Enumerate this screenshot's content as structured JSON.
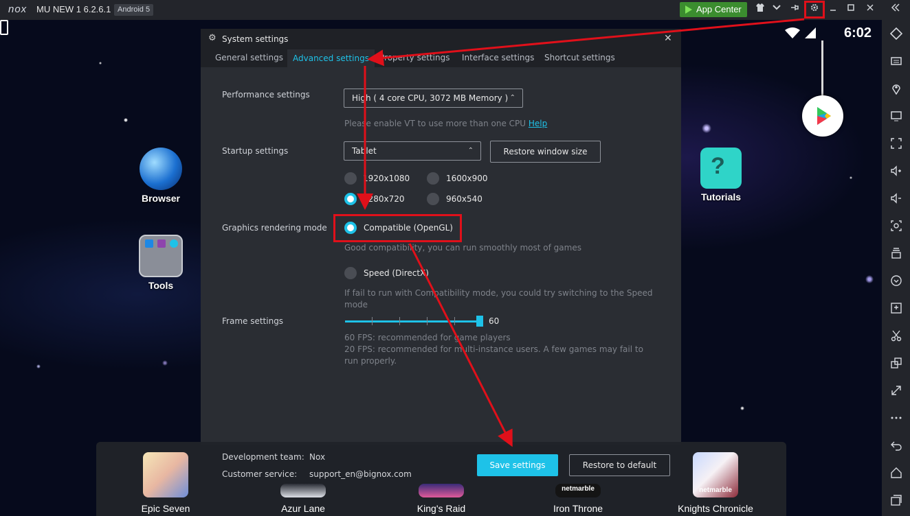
{
  "titlebar": {
    "logo": "nox",
    "title": "MU NEW 1 6.2.6.1",
    "android_badge": "Android 5",
    "app_center_label": "App Center"
  },
  "screen": {
    "time": "6:02",
    "apps": [
      {
        "label": "Browser"
      },
      {
        "label": "Tools"
      },
      {
        "label": "Tutorials"
      }
    ]
  },
  "dialog": {
    "title": "System settings",
    "tabs": [
      "General settings",
      "Advanced settings",
      "Property settings",
      "Interface settings",
      "Shortcut settings"
    ],
    "performance": {
      "label": "Performance settings",
      "value": "High ( 4 core CPU, 3072 MB Memory )",
      "hint": "Please enable VT to use more than one CPU",
      "hint_link": "Help"
    },
    "startup": {
      "label": "Startup settings",
      "value": "Tablet",
      "restore_button": "Restore window size",
      "resolutions": [
        "1920x1080",
        "1600x900",
        "1280x720",
        "960x540"
      ],
      "selected": "1280x720"
    },
    "graphics": {
      "label": "Graphics rendering mode",
      "compatible": "Compatible (OpenGL)",
      "compatible_hint": "Good compatibility, you can run smoothly most of games",
      "speed": "Speed (DirectX)",
      "speed_hint": "If fail to run with Compatibility mode, you could try switching to the Speed mode"
    },
    "frame": {
      "label": "Frame settings",
      "value": "60",
      "hint_1": "60 FPS: recommended for game players",
      "hint_2": "20 FPS: recommended for multi-instance users. A few games may fail to run properly."
    }
  },
  "footer": {
    "dev_team_key": "Development team:",
    "dev_team_value": "Nox",
    "customer_service_key": "Customer service:",
    "customer_service_value": "support_en@bignox.com",
    "save_button": "Save settings",
    "restore_default_button": "Restore to default",
    "games": [
      {
        "label": "Epic Seven"
      },
      {
        "label": "Azur Lane"
      },
      {
        "label": "King's Raid"
      },
      {
        "label": "Iron Throne",
        "badge": "netmarble"
      },
      {
        "label": "Knights Chronicle",
        "badge": "netmarble"
      }
    ]
  },
  "colors": {
    "accent": "#1ec2e8",
    "annotation": "#e0101a",
    "app_center": "#3b8d2f"
  }
}
